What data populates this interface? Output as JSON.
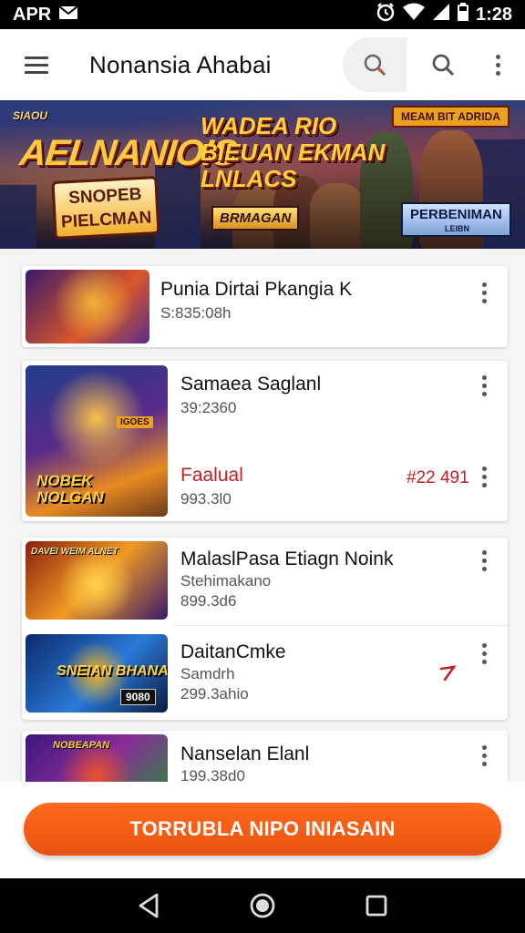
{
  "status_bar": {
    "left": "APR",
    "time": "1:28",
    "mail_icon": "mail-icon",
    "alarm_icon": "alarm-icon",
    "wifi_icon": "wifi-icon",
    "battery_icon": "battery-icon"
  },
  "app_bar": {
    "title": "Nonansia Ahabai",
    "menu_icon": "hamburger-icon",
    "search_icon": "search-icon",
    "more_icon": "more-vert-icon"
  },
  "banner": {
    "small_text": "SIAOU",
    "logo": "AELNANIOIS",
    "sub_box": "SNOPEB PIELCMAN",
    "headline": "WADEA RIO BIEUAN EKMAN LNLACS",
    "ribbon": "MEAM BIT ADRIDA",
    "tag_left": "BRMAGAN",
    "tag_right": "PERBENIMAN",
    "tag_right_sub": "LEIBN"
  },
  "items": [
    {
      "title": "Punia Dirtai Pkangia K",
      "subtitle": "S:835:08h",
      "thumb_colors": [
        "#3b1a6a",
        "#d9562a",
        "#5b2e8a"
      ]
    },
    {
      "title": "Samaea Saglanl",
      "subtitle": "39:2360",
      "title2": "Faalual",
      "subtitle2": "993.3l0",
      "price": "#22 491",
      "price_color": "#c62020",
      "thumb_label": "NOBEK NOLGAN",
      "thumb_badge": "IGOES",
      "thumb_colors": [
        "#1f3f8a",
        "#e88a22",
        "#6a3a1a"
      ]
    },
    {
      "title": "MalaslPasa Etiagn Noink",
      "subtitle": "Stehimakano",
      "subtitle_b": "899.3d6",
      "thumb_label": "DAVEI WEIM ALNET",
      "thumb_colors": [
        "#8a1e10",
        "#f09a24",
        "#3a1a6a"
      ]
    },
    {
      "title": "DaitanCmke",
      "subtitle": "Samdrh",
      "subtitle_b": "299.3ahio",
      "thumb_label": "SNEIAN BHANA",
      "thumb_badge": "9080",
      "trend_icon": "trend-arrow-icon",
      "thumb_colors": [
        "#0c2a6a",
        "#2a7ad8",
        "#f0b020"
      ]
    },
    {
      "title": "Nanselan Elanl",
      "subtitle": "199.38d0",
      "thumb_label": "NOBEAPAN",
      "thumb_colors": [
        "#3a1a7a",
        "#e9532a",
        "#2a8a3a"
      ]
    }
  ],
  "cta": {
    "label": "TORRUBLA NIPO INIASAIN",
    "color": "#ff6a1d"
  },
  "nav": {
    "back_icon": "back-triangle-icon",
    "home_icon": "home-circle-icon",
    "recents_icon": "recents-square-icon"
  }
}
